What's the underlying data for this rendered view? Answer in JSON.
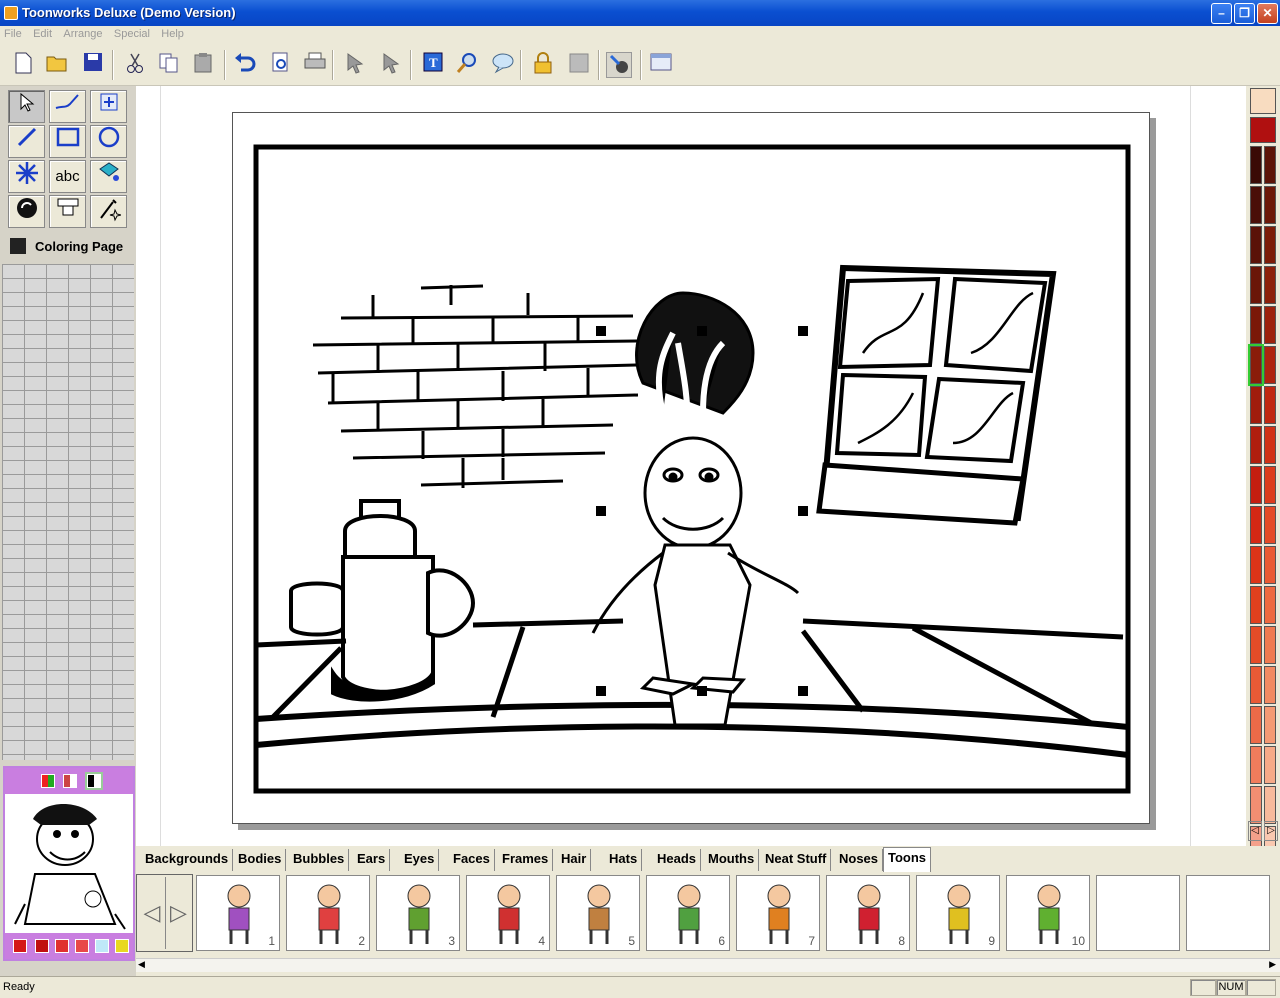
{
  "window": {
    "title": "Toonworks Deluxe (Demo Version)",
    "min": "–",
    "max": "❐",
    "close": "✕"
  },
  "menu": [
    "File",
    "Edit",
    "Arrange",
    "Special",
    "Help"
  ],
  "tools": {
    "text_tool": "abc",
    "mode_label": "Coloring Page"
  },
  "tabs": [
    "Backgrounds",
    "Bodies",
    "Bubbles",
    "Ears",
    "Eyes",
    "Faces",
    "Frames",
    "Hair",
    "Hats",
    "Heads",
    "Mouths",
    "Neat Stuff",
    "Noses",
    "Toons"
  ],
  "active_tab": "Toons",
  "thumbs": [
    "1",
    "2",
    "3",
    "4",
    "5",
    "6",
    "7",
    "8",
    "9",
    "10"
  ],
  "status": {
    "text": "Ready",
    "num": "NUM"
  },
  "colors": {
    "accent": "#0a4fd1",
    "palette_left": [
      "#f8dcc0",
      "#b01010",
      "#3a0a06",
      "#4a0e08",
      "#5a1208",
      "#6a1608",
      "#7a1808",
      "#8a1c0a",
      "#a01c0c",
      "#b01e0e",
      "#c41e10",
      "#d42814",
      "#dc3418",
      "#e0401e",
      "#e44c28",
      "#e85a36",
      "#ec6a48",
      "#f07c5c",
      "#f28e72",
      "#f4a08a"
    ],
    "palette_right": [
      "#3a0a06",
      "#4a0e08",
      "#5c1408",
      "#6c1808",
      "#7c1c08",
      "#8c200a",
      "#9c220c",
      "#ae240e",
      "#c02810",
      "#d03216",
      "#dc3c1c",
      "#e44a26",
      "#ea5a32",
      "#ee6a40",
      "#f07a50",
      "#f28a62",
      "#f49a74",
      "#f6aa88",
      "#f8ba9c",
      "#fac8b0"
    ]
  }
}
